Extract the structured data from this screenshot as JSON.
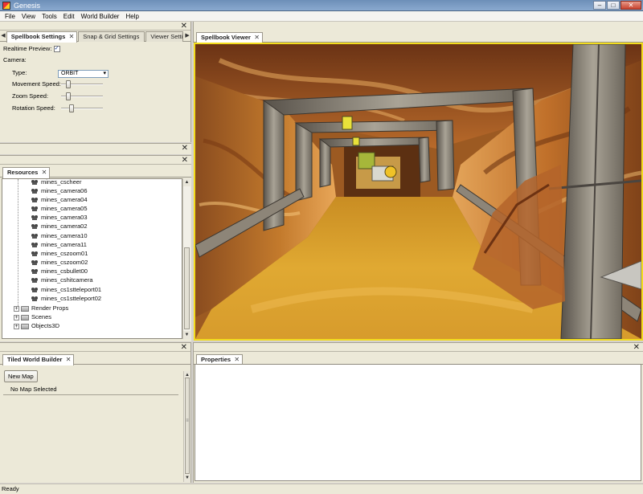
{
  "window": {
    "title": "Genesis",
    "minimize": "–",
    "maximize": "□",
    "close": "✕"
  },
  "menu": [
    "File",
    "View",
    "Tools",
    "Edit",
    "World Builder",
    "Help"
  ],
  "top_left": {
    "close": "✕",
    "tabs": [
      "Spellbook Settings",
      "Snap & Grid Settings",
      "Viewer Settin"
    ],
    "tab_close": "✕",
    "arrow_left": "◀",
    "arrow_right": "▶",
    "realtime_label": "Realtime Preview:",
    "realtime_checked": "✓",
    "camera_label": "Camera:",
    "type_label": "Type:",
    "type_value": "ORBIT",
    "type_chevron": "▾",
    "movement_label": "Movement Speed:",
    "zoom_label": "Zoom Speed:",
    "rotation_label": "Rotation Speed:",
    "movement_level": 0.12,
    "zoom_level": 0.12,
    "rotation_level": 0.22
  },
  "empty_panel": {
    "close": "✕"
  },
  "resources": {
    "close": "✕",
    "tab": "Resources",
    "tab_close": "✕",
    "cameras": [
      "mines_cscheer",
      "mines_camera06",
      "mines_camera04",
      "mines_camera05",
      "mines_camera03",
      "mines_camera02",
      "mines_camera10",
      "mines_camera11",
      "mines_cszoom01",
      "mines_cszoom02",
      "mines_csbullet00",
      "mines_cshitcamera",
      "mines_cs1stteleport01",
      "mines_cs1stteleport02"
    ],
    "folders": [
      "Render Props",
      "Scenes",
      "Objects3D"
    ],
    "expander": "+"
  },
  "viewer": {
    "tab": "Spellbook Viewer",
    "tab_close": "✕",
    "close": "✕"
  },
  "tiled": {
    "close": "✕",
    "tab": "Tiled World Builder",
    "tab_close": "✕",
    "new_map": "New Map",
    "status": "No Map Selected"
  },
  "properties": {
    "close": "✕",
    "tab": "Properties",
    "tab_close": "✕"
  },
  "scroll": {
    "up": "▲",
    "down": "▼",
    "grip": "≡"
  },
  "statusbar": {
    "text": "Ready"
  },
  "colors": {
    "viewer_border": "#f2dc1e",
    "title_bar": "#7a9bc4"
  }
}
